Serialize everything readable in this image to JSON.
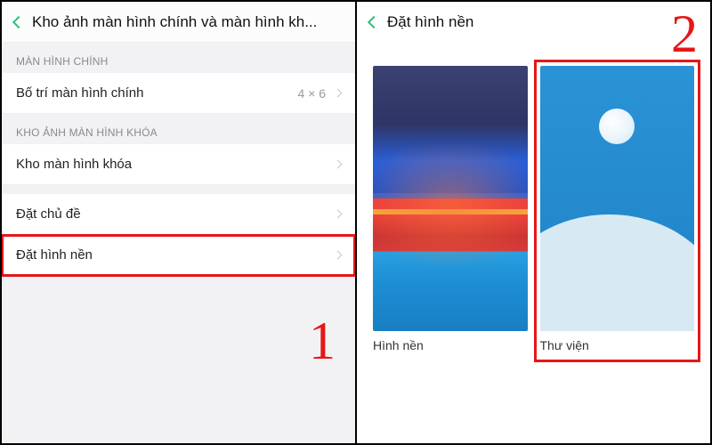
{
  "left": {
    "title": "Kho ảnh màn hình chính và màn hình kh...",
    "section1_header": "MÀN HÌNH CHÍNH",
    "row_layout": {
      "label": "Bố trí màn hình chính",
      "value": "4 × 6"
    },
    "section2_header": "KHO ẢNH MÀN HÌNH KHÓA",
    "row_lock": {
      "label": "Kho màn hình khóa"
    },
    "row_theme": {
      "label": "Đặt chủ đề"
    },
    "row_wallpaper": {
      "label": "Đặt hình nền"
    },
    "step_number": "1"
  },
  "right": {
    "title": "Đặt hình nền",
    "item_wallpaper": {
      "label": "Hình nền"
    },
    "item_gallery": {
      "label": "Thư viện"
    },
    "step_number": "2"
  },
  "colors": {
    "highlight": "#e61717",
    "accent_back": "#2bc17b"
  }
}
